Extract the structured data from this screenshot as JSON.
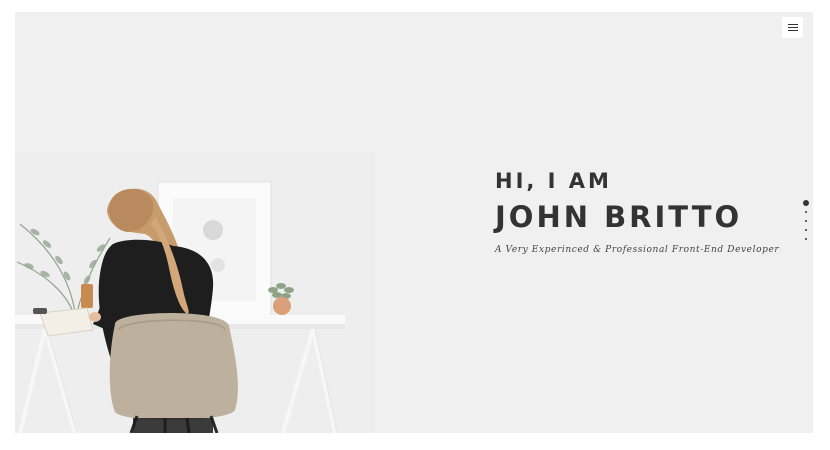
{
  "nav": {
    "menu_icon": "hamburger-menu-icon"
  },
  "hero": {
    "greeting": "HI, I AM",
    "name": "JOHN BRITTO",
    "tagline": "A Very Experinced & Professional Front-End Developer",
    "image_description": "woman-at-desk"
  },
  "pagination": {
    "count": 5,
    "active_index": 0
  },
  "colors": {
    "text": "#333333",
    "background": "#f0f0f0"
  }
}
